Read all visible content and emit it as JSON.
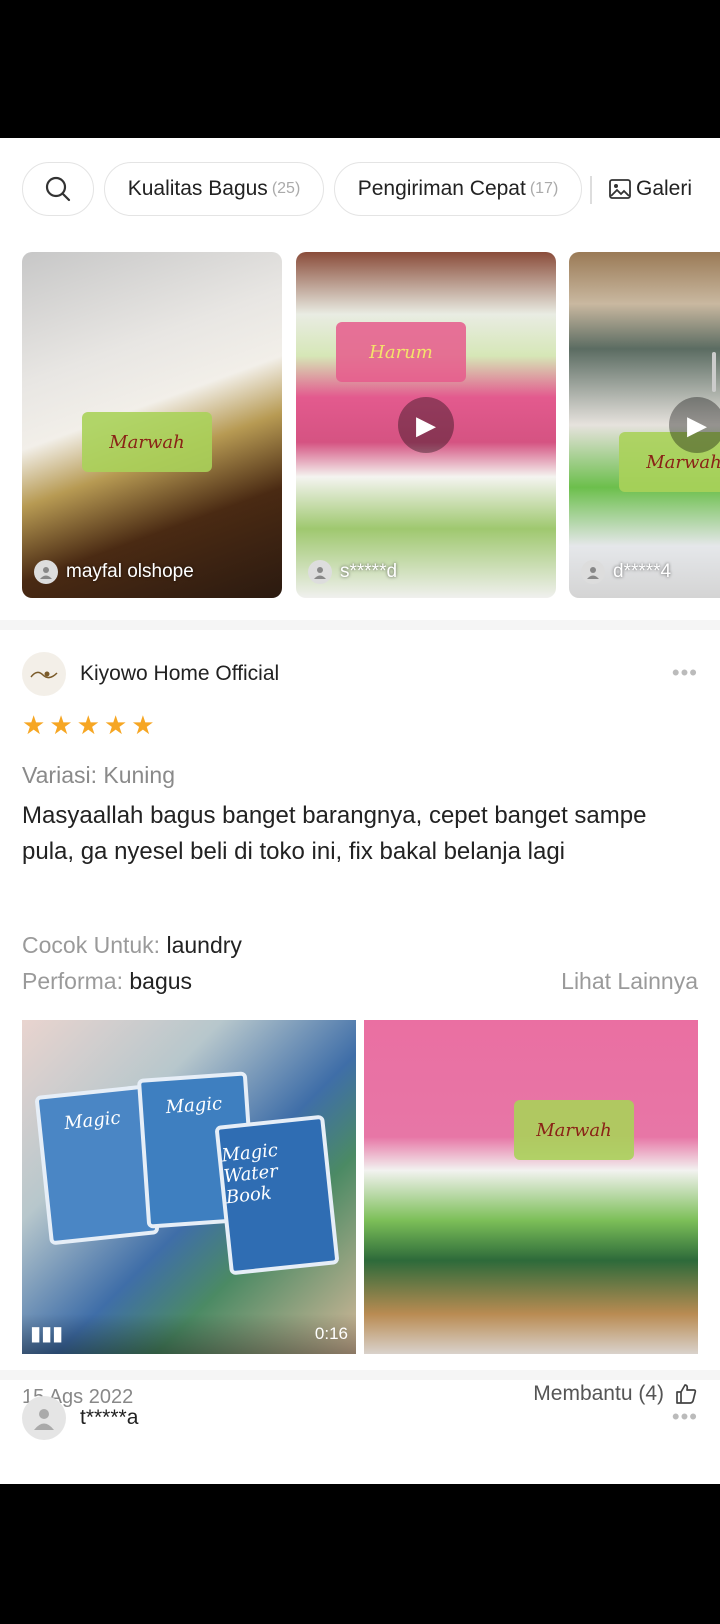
{
  "filters": {
    "kualitas_label": "Kualitas Bagus",
    "kualitas_count": "(25)",
    "pengiriman_label": "Pengiriman Cepat",
    "pengiriman_count": "(17)",
    "galeri_label": "Galeri"
  },
  "videos": [
    {
      "user": "mayfal olshope",
      "product_text": "Marwah"
    },
    {
      "user": "s*****d",
      "product_text": "Harum"
    },
    {
      "user": "d*****4",
      "product_text": "Marwah"
    }
  ],
  "review": {
    "shop_name": "Kiyowo Home Official",
    "stars": 5,
    "variasi": "Variasi: Kuning",
    "comment": "Masyaallah bagus banget barangnya, cepet banget sampe pula, ga nyesel beli di toko ini, fix bakal belanja lagi",
    "cocok_label": "Cocok Untuk: ",
    "cocok_value": "laundry",
    "performa_label": "Performa: ",
    "performa_value": "bagus",
    "lihat_lainnya": "Lihat Lainnya",
    "video_duration": "0:16",
    "book_text": "Magic Water Book",
    "product_text": "Marwah",
    "date": "15 Ags 2022",
    "helpful": "Membantu (4)"
  },
  "next_review": {
    "user": "t*****a"
  },
  "colors": {
    "star": "#f6a623",
    "muted": "#8a8a8a"
  }
}
